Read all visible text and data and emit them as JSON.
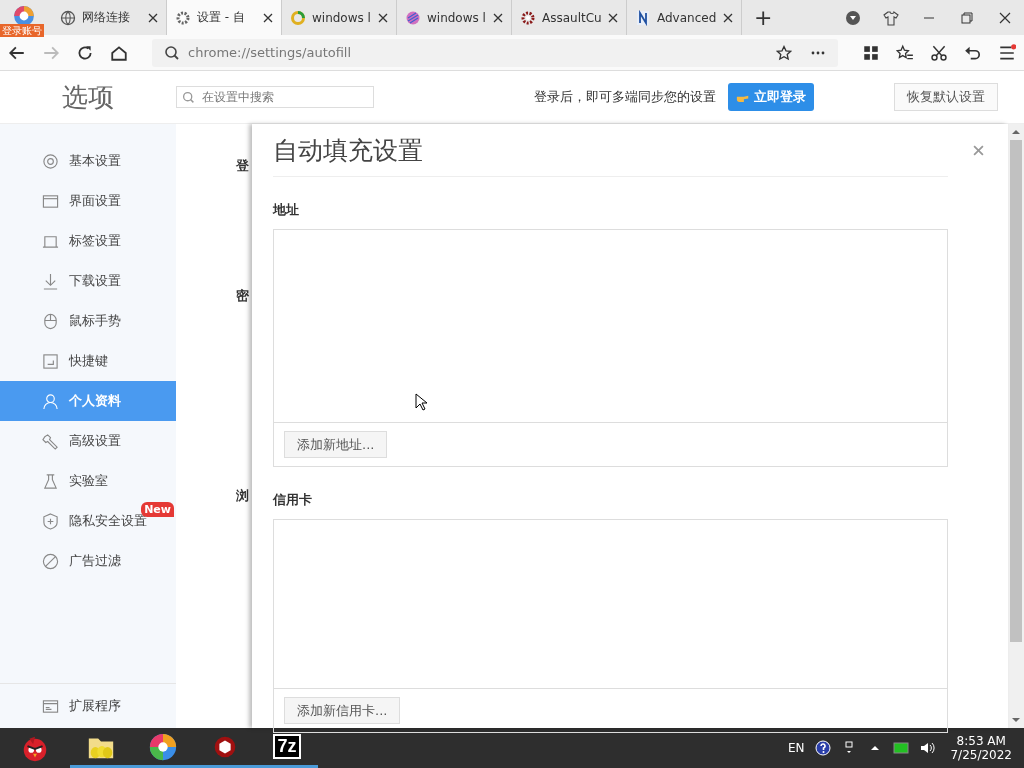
{
  "browser": {
    "account_badge": "登录账号",
    "tabs": [
      {
        "label": "网络连接",
        "selected": false
      },
      {
        "label": "设置 - 自",
        "selected": true
      },
      {
        "label": "windows l",
        "selected": false
      },
      {
        "label": "windows l",
        "selected": false
      },
      {
        "label": "AssaultCu",
        "selected": false
      },
      {
        "label": "Advanced",
        "selected": false
      }
    ],
    "new_tab": "+",
    "address": "chrome://settings/autofill"
  },
  "header": {
    "title": "选项",
    "search_placeholder": "在设置中搜索",
    "sync_text": "登录后，即可多端同步您的设置",
    "login_button": "立即登录",
    "restore_button": "恢复默认设置"
  },
  "sidebar": {
    "items": [
      {
        "label": "基本设置",
        "selected": false
      },
      {
        "label": "界面设置",
        "selected": false
      },
      {
        "label": "标签设置",
        "selected": false
      },
      {
        "label": "下载设置",
        "selected": false
      },
      {
        "label": "鼠标手势",
        "selected": false
      },
      {
        "label": "快捷键",
        "selected": false
      },
      {
        "label": "个人资料",
        "selected": true
      },
      {
        "label": "高级设置",
        "selected": false
      },
      {
        "label": "实验室",
        "selected": false
      },
      {
        "label": "隐私安全设置",
        "selected": false,
        "badge": "New"
      },
      {
        "label": "广告过滤",
        "selected": false
      }
    ],
    "footer_item": {
      "label": "扩展程序"
    }
  },
  "behind_labels": [
    "登",
    "密",
    "浏"
  ],
  "dialog": {
    "title": "自动填充设置",
    "sections": [
      {
        "heading": "地址",
        "button": "添加新地址..."
      },
      {
        "heading": "信用卡",
        "button": "添加新信用卡..."
      }
    ]
  },
  "taskbar": {
    "zip_label": "7z",
    "language": "EN",
    "time": "8:53 AM",
    "date": "7/25/2022"
  }
}
